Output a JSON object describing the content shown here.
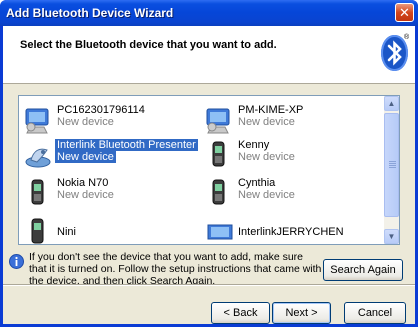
{
  "window": {
    "title": "Add Bluetooth Device Wizard"
  },
  "header": {
    "title": "Select the Bluetooth device that you want to add.",
    "registered_mark": "®"
  },
  "devices": [
    {
      "name": "PC162301796114",
      "status": "New device",
      "icon": "computer-icon"
    },
    {
      "name": "PM-KIME-XP",
      "status": "New device",
      "icon": "computer-icon"
    },
    {
      "name": "Interlink Bluetooth Presenter",
      "status": "New device",
      "icon": "presenter-icon",
      "selected": true
    },
    {
      "name": "Kenny",
      "status": "New device",
      "icon": "phone-icon"
    },
    {
      "name": "Nokia N70",
      "status": "New device",
      "icon": "phone-icon"
    },
    {
      "name": "Cynthia",
      "status": "New device",
      "icon": "phone-icon"
    },
    {
      "name": "Nini",
      "status": "",
      "icon": "phone-icon"
    },
    {
      "name": "InterlinkJERRYCHEN",
      "status": "",
      "icon": "laptop-icon"
    }
  ],
  "info": {
    "text": "If you don't see the device that you want to add, make sure that it is turned on. Follow the setup instructions that came with the device, and then click Search Again.",
    "icon": "info-icon"
  },
  "buttons": {
    "search_again": "Search Again",
    "back": "< Back",
    "next": "Next >",
    "cancel": "Cancel"
  },
  "scrollbar": {
    "up": "▲",
    "down": "▼"
  },
  "colors": {
    "title_bar": "#0a4fe0",
    "selection": "#316ac5",
    "dialog_bg": "#ece9d8"
  }
}
